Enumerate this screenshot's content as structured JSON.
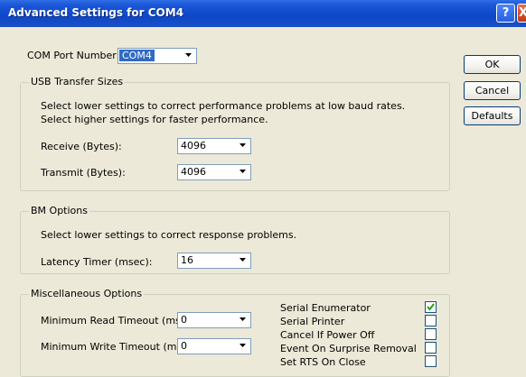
{
  "window": {
    "title": "Advanced Settings for COM4",
    "help_glyph": "?",
    "close_glyph": "X"
  },
  "com_port": {
    "label": "COM Port Number:",
    "value": "COM4"
  },
  "buttons": {
    "ok": "OK",
    "cancel": "Cancel",
    "defaults": "Defaults"
  },
  "usb_transfer": {
    "title": "USB Transfer Sizes",
    "desc_line1": "Select lower settings to correct performance problems at low baud rates.",
    "desc_line2": "Select higher settings for faster performance.",
    "receive_label": "Receive (Bytes):",
    "receive_value": "4096",
    "transmit_label": "Transmit (Bytes):",
    "transmit_value": "4096"
  },
  "bm_options": {
    "title": "BM Options",
    "desc": "Select lower settings to correct response problems.",
    "latency_label": "Latency Timer (msec):",
    "latency_value": "16"
  },
  "misc_options": {
    "title": "Miscellaneous Options",
    "min_read_label": "Minimum Read Timeout (msec):",
    "min_read_value": "0",
    "min_write_label": "Minimum Write Timeout (msec):",
    "min_write_value": "0",
    "checkboxes": [
      {
        "label": "Serial Enumerator",
        "checked": true
      },
      {
        "label": "Serial Printer",
        "checked": false
      },
      {
        "label": "Cancel If Power Off",
        "checked": false
      },
      {
        "label": "Event On Surprise Removal",
        "checked": false
      },
      {
        "label": "Set RTS On Close",
        "checked": false
      }
    ]
  },
  "colors": {
    "title_bar": "#0d47c9",
    "dialog_bg": "#ece9d8",
    "selection": "#316ac5"
  }
}
